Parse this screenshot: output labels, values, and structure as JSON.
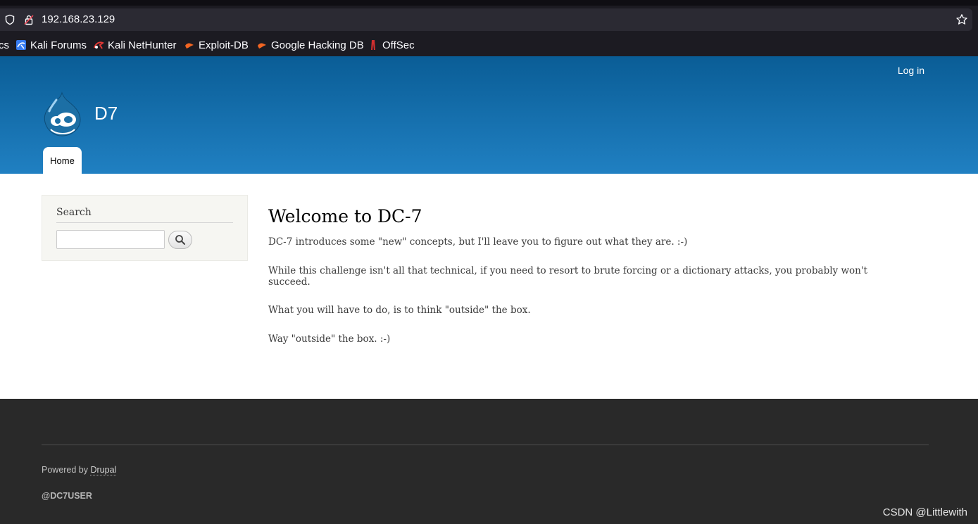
{
  "browser": {
    "url": "192.168.23.129",
    "bookmarks": [
      {
        "label": "cs",
        "icon": "kali-docs-icon"
      },
      {
        "label": "Kali Forums",
        "icon": "kali-forums-icon"
      },
      {
        "label": "Kali NetHunter",
        "icon": "kali-nethunter-icon"
      },
      {
        "label": "Exploit-DB",
        "icon": "exploit-db-icon"
      },
      {
        "label": "Google Hacking DB",
        "icon": "ghdb-icon"
      },
      {
        "label": "OffSec",
        "icon": "offsec-icon"
      }
    ]
  },
  "header": {
    "login": "Log in",
    "site_name": "D7",
    "nav_home": "Home"
  },
  "sidebar": {
    "search_title": "Search",
    "search_value": ""
  },
  "main": {
    "title": "Welcome to DC-7",
    "paragraphs": [
      "DC-7 introduces some \"new\" concepts, but I'll leave you to figure out what they are.  :-)",
      "While this challenge isn't all that technical, if you need to resort to brute forcing or a dictionary attacks, you probably won't succeed.",
      "What you will have to do, is to think \"outside\" the box.",
      "Way \"outside\" the box.  :-)"
    ]
  },
  "footer": {
    "powered_prefix": "Powered by ",
    "powered_link": "Drupal",
    "user_tag": "@DC7USER",
    "watermark": "CSDN @Littlewith"
  },
  "colors": {
    "header_top": "#0a5d96",
    "header_bottom": "#2080c2",
    "footer_bg": "#292929",
    "chrome_bg": "#1c1b22"
  }
}
